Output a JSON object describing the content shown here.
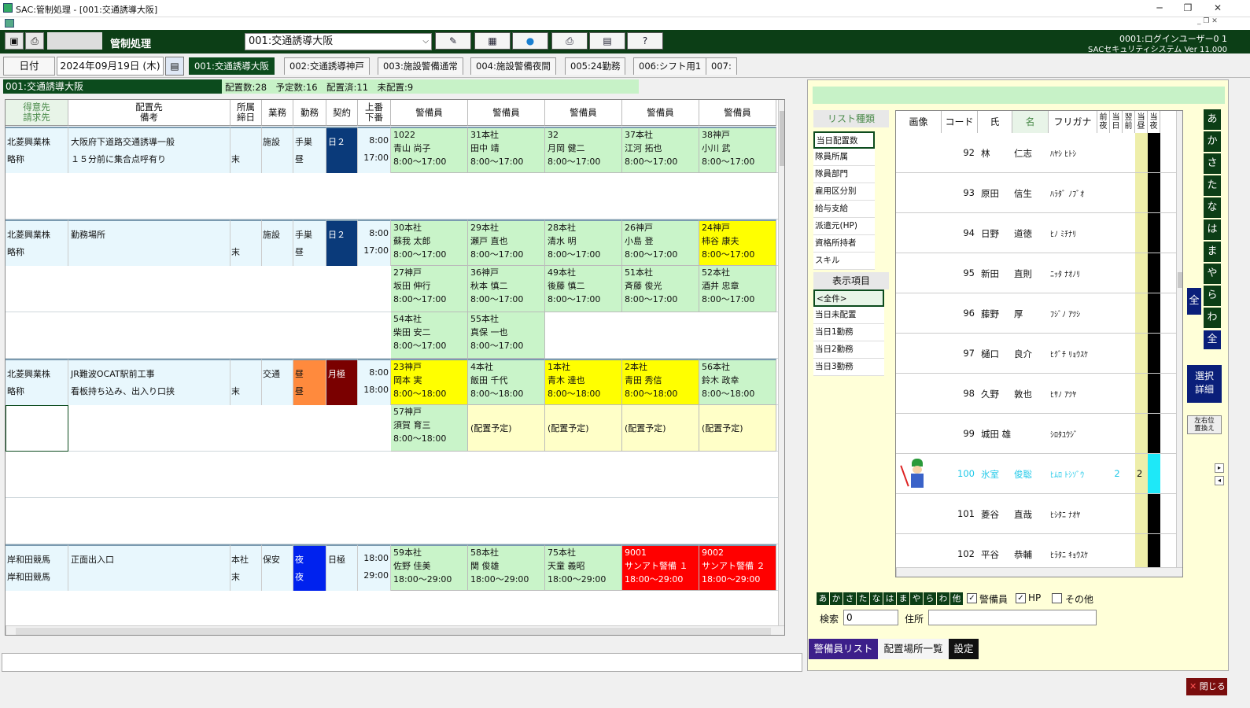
{
  "window": {
    "title": "SAC:管制処理 - [001:交通誘導大阪]",
    "min": "─",
    "max": "❐",
    "close": "✕"
  },
  "toolbar": {
    "title": "管制処理",
    "site_select": "001:交通誘導大阪",
    "user": "0001:ログインユーザー0 1",
    "system": "SACセキュリティシステム Ver 11.000"
  },
  "date": {
    "label": "日付",
    "value": "2024年09月19日 (木)"
  },
  "tabs": [
    "001:交通誘導大阪",
    "002:交通誘導神戸",
    "003:施設警備通常",
    "004:施設警備夜間",
    "005:24勤務",
    "006:シフト用1",
    "007:"
  ],
  "summary": {
    "site": "001:交通誘導大阪",
    "stats": "配置数:28　予定数:16　配置済:11　未配置:9"
  },
  "grid": {
    "headers": {
      "customer": "得意先\n請求先",
      "location": "配置先\n備考",
      "dept": "所属\n締日",
      "work": "業務",
      "shift": "勤務",
      "contract": "契約",
      "times": "上番\n下番",
      "guard": "警備員"
    },
    "blocks": [
      {
        "c1": "北菱興業株",
        "c2": "略称",
        "l1": "大阪府下道路交通誘導一般",
        "l2": "１５分前に集合点呼有り",
        "dept": "",
        "close": "末",
        "work": "施設",
        "shift1": "手巣",
        "shift2": "昼",
        "contract": "日２",
        "t1": "8:00",
        "t2": "17:00"
      },
      {
        "c1": "北菱興業株",
        "c2": "略称",
        "l1": "勤務場所",
        "l2": "",
        "dept": "",
        "close": "末",
        "work": "施設",
        "shift1": "手巣",
        "shift2": "昼",
        "contract": "日２",
        "t1": "8:00",
        "t2": "17:00"
      },
      {
        "c1": "北菱興業株",
        "c2": "略称",
        "l1": "JR難波OCAT駅前工事",
        "l2": "看板持ち込み、出入り口挟",
        "dept": "",
        "close": "末",
        "work": "交通",
        "shift1": "昼",
        "shift2": "昼",
        "contract": "月極",
        "t1": "8:00",
        "t2": "18:00"
      },
      {
        "c1": "岸和田競馬",
        "c2": "岸和田競馬",
        "l1": "正面出入口",
        "l2": "",
        "dept": "本社",
        "close": "末",
        "work": "保安",
        "shift1": "夜",
        "shift2": "夜",
        "contract": "日極",
        "t1": "18:00",
        "t2": "29:00"
      }
    ],
    "g": [
      [
        [
          "1022",
          "青山 尚子",
          "8:00～17:00"
        ],
        [
          "31本社",
          "田中 靖",
          "8:00～17:00"
        ],
        [
          "32",
          "月岡 健二",
          "8:00～17:00"
        ],
        [
          "37本社",
          "江河 拓也",
          "8:00～17:00"
        ],
        [
          "38神戸",
          "小川 武",
          "8:00～17:00"
        ]
      ],
      [
        [
          "30本社",
          "蘇我 太郎",
          "8:00～17:00"
        ],
        [
          "29本社",
          "瀬戸 直也",
          "8:00～17:00"
        ],
        [
          "28本社",
          "清水 明",
          "8:00～17:00"
        ],
        [
          "26神戸",
          "小島 登",
          "8:00～17:00"
        ],
        [
          "24神戸",
          "柿谷 康夫",
          "8:00～17:00"
        ]
      ],
      [
        [
          "27神戸",
          "坂田 伸行",
          "8:00～17:00"
        ],
        [
          "36神戸",
          "秋本 慎二",
          "8:00～17:00"
        ],
        [
          "49本社",
          "後藤 慎二",
          "8:00～17:00"
        ],
        [
          "51本社",
          "斉藤 俊光",
          "8:00～17:00"
        ],
        [
          "52本社",
          "酒井 忠章",
          "8:00～17:00"
        ]
      ],
      [
        [
          "54本社",
          "柴田 安二",
          "8:00～17:00"
        ],
        [
          "55本社",
          "真保 一也",
          "8:00～17:00"
        ]
      ],
      [
        [
          "23神戸",
          "岡本 実",
          "8:00～18:00"
        ],
        [
          "4本社",
          "飯田 千代",
          "8:00～18:00"
        ],
        [
          "1本社",
          "青木 達也",
          "8:00～18:00"
        ],
        [
          "2本社",
          "青田 秀信",
          "8:00～18:00"
        ],
        [
          "56本社",
          "鈴木 政幸",
          "8:00～18:00"
        ]
      ],
      [
        [
          "57神戸",
          "須賀 育三",
          "8:00～18:00"
        ]
      ],
      [
        [
          "59本社",
          "佐野 佳美",
          "18:00～29:00"
        ],
        [
          "58本社",
          "関 俊雄",
          "18:00～29:00"
        ],
        [
          "75本社",
          "天童 義昭",
          "18:00～29:00"
        ],
        [
          "9001",
          "サンアト警備 １",
          "18:00～29:00"
        ],
        [
          "9002",
          "サンアト警備 ２",
          "18:00～29:00"
        ]
      ]
    ],
    "pending": "(配置予定)"
  },
  "right": {
    "list_type": "リスト種類",
    "list_items": [
      "当日配置数",
      "隊員所属",
      "隊員部門",
      "雇用区分別",
      "給与支給",
      "派遣元(HP)",
      "資格所持者",
      "スキル"
    ],
    "display": "表示項目",
    "display_items": [
      "<全件>",
      "当日未配置",
      "当日1勤務",
      "当日2勤務",
      "当日3勤務"
    ],
    "emp_headers": [
      "画像",
      "コード",
      "氏",
      "名",
      "フリガナ",
      "前夜",
      "当日",
      "翌前",
      "当昼",
      "当夜"
    ],
    "employees": [
      [
        "92",
        "林",
        "仁志",
        "ﾊﾔｼ ﾋﾄｼ"
      ],
      [
        "93",
        "原田",
        "信生",
        "ﾊﾗﾀﾞ ﾉﾌﾞｵ"
      ],
      [
        "94",
        "日野",
        "道徳",
        "ﾋﾉ ﾐﾁﾅﾘ"
      ],
      [
        "95",
        "新田",
        "直則",
        "ﾆｯﾀ ﾅｵﾉﾘ"
      ],
      [
        "96",
        "藤野",
        "厚",
        "ﾌｼﾞﾉ ｱﾂｼ"
      ],
      [
        "97",
        "樋口",
        "良介",
        "ﾋｸﾞﾁ ﾘｮｳｽｹ"
      ],
      [
        "98",
        "久野",
        "敦也",
        "ﾋｻﾉ ｱﾂﾔ"
      ],
      [
        "99",
        "城田 雄",
        "",
        "ｼﾛﾀﾕｳｼﾞ"
      ],
      [
        "100",
        "氷室",
        "俊聡",
        "ﾋﾑﾛ ﾄｼｿﾞｳ"
      ],
      [
        "101",
        "菱谷",
        "直哉",
        "ﾋｼﾀﾆ ﾅｵﾔ"
      ],
      [
        "102",
        "平谷",
        "恭輔",
        "ﾋﾗﾀﾆ ｷｮｳｽｹ"
      ]
    ],
    "emp100_count": "2",
    "emp100_count2": "2",
    "kana": [
      "あ",
      "か",
      "さ",
      "た",
      "な",
      "は",
      "ま",
      "や",
      "ら",
      "わ"
    ],
    "all": "全",
    "select_detail": "選択\n詳細",
    "swap": "左右位\n置換え",
    "filter_kana": [
      "あ",
      "か",
      "さ",
      "た",
      "な",
      "は",
      "ま",
      "や",
      "ら",
      "わ",
      "他"
    ],
    "chk_guard": "警備員",
    "chk_hp": "HP",
    "chk_other": "その他",
    "search_label": "検索",
    "search_value": "0",
    "address_label": "住所",
    "tabs": [
      "警備員リスト",
      "配置場所一覧",
      "設定"
    ],
    "close": "閉じる"
  }
}
